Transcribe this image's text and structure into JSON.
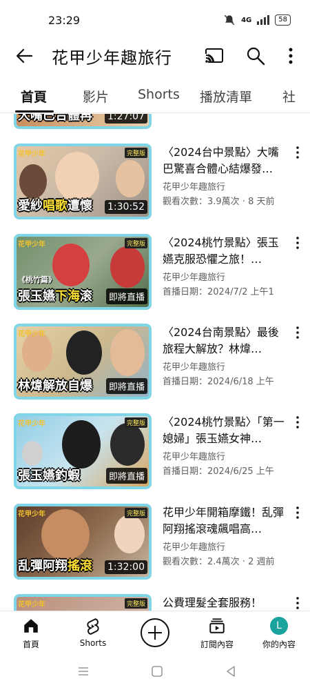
{
  "status": {
    "time": "23:29",
    "network": "4G",
    "battery": "58"
  },
  "appbar": {
    "title": "花甲少年趣旅行"
  },
  "tabs": [
    "首頁",
    "影片",
    "Shorts",
    "播放清單",
    "社"
  ],
  "partial_top": {
    "overlay": "大嘴巴合體再",
    "duration": "1:27:07"
  },
  "videos": [
    {
      "title": "〈2024台中景點〉大嘴巴驚喜合體心結爆發…",
      "channel": "花甲少年趣旅行",
      "stats": "觀看次數：3.9萬次 · 8 天前",
      "badge": "完整版",
      "overlay_a": "愛紗",
      "overlay_b": "唱歌",
      "overlay_c": "遭懷",
      "duration": "1:30:52"
    },
    {
      "title": "〈2024桃竹景點〉張玉嬿克服恐懼之旅！…",
      "channel": "花甲少年趣旅行",
      "stats": "首播日期：2024/7/2 上午1",
      "badge": "完整版",
      "overlay_a": "張玉嬿",
      "overlay_b": "下海",
      "overlay_c": "滚",
      "duration": "即將直播",
      "tag": "《桃竹篇》"
    },
    {
      "title": "〈2024台南景點〉最後旅程大解放？林煒…",
      "channel": "花甲少年趣旅行",
      "stats": "首播日期：2024/6/18 上午",
      "badge": "",
      "overlay_a": "林煒",
      "overlay_b": "解放",
      "overlay_c": "自爆",
      "duration": "即將直播"
    },
    {
      "title": "〈2024桃竹景點〉「第一媳婦」張玉嬿女神…",
      "channel": "花甲少年趣旅行",
      "stats": "首播日期：2024/6/25 上午",
      "badge": "完整版",
      "overlay_a": "張玉嬿",
      "overlay_b": "釣蝦",
      "overlay_c": "",
      "duration": "即將直播"
    },
    {
      "title": "花甲少年開箱摩鐵！乱彈阿翔搖滾魂飆唱高…",
      "channel": "花甲少年趣旅行",
      "stats": "觀看次數：2.4萬次 · 2 週前",
      "badge": "完整版",
      "overlay_a": "乱彈阿翔",
      "overlay_b": "搖滾",
      "overlay_c": "",
      "duration": "1:32:00"
    },
    {
      "title": "公費理髮全套服務！",
      "channel": "",
      "stats": "",
      "badge": "完整版",
      "overlay_a": "",
      "overlay_b": "",
      "overlay_c": "",
      "duration": ""
    }
  ],
  "thumb_logo": "花甲少年",
  "bottomnav": {
    "home": "首頁",
    "shorts": "Shorts",
    "subs": "訂閱內容",
    "you": "你的內容",
    "avatar_letter": "L"
  },
  "colors": {
    "accent_frame": "#7fd6e8",
    "avatar": "#1aa39e",
    "overlay_highlight": "#ffe034"
  }
}
